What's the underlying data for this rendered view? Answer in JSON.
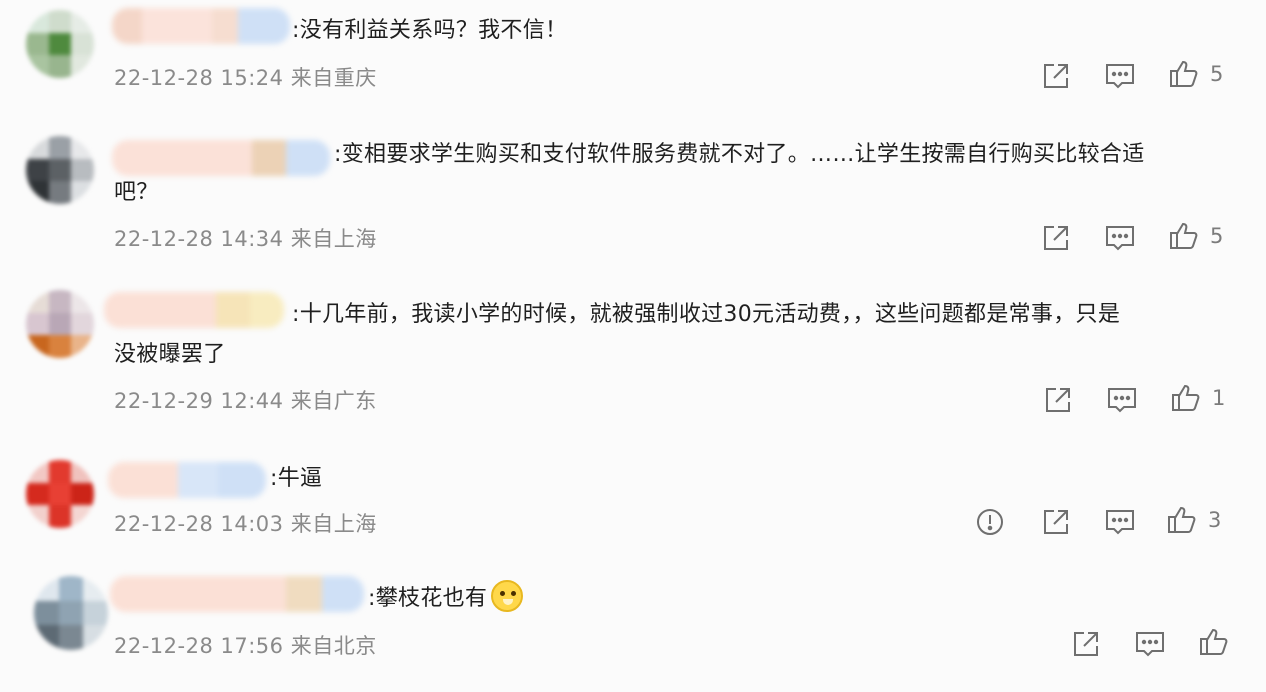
{
  "comments": [
    {
      "separator": ":",
      "text": "没有利益关系吗？我不信！",
      "text2": "",
      "date": "22-12-28 15:24",
      "location": "来自重庆",
      "likes": "5",
      "report": false
    },
    {
      "separator": ":",
      "text": "变相要求学生购买和支付软件服务费就不对了。……让学生按需自行购买比较合适",
      "text2": "吧？",
      "date": "22-12-28 14:34",
      "location": "来自上海",
      "likes": "5",
      "report": false
    },
    {
      "separator": ":",
      "text": "十几年前，我读小学的时候，就被强制收过30元活动费，，这些问题都是常事，只是",
      "text2": "没被曝罢了",
      "date": "22-12-29 12:44",
      "location": "来自广东",
      "likes": "1",
      "report": false
    },
    {
      "separator": ":",
      "text": "牛逼",
      "text2": "",
      "date": "22-12-28 14:03",
      "location": "来自上海",
      "likes": "3",
      "report": true
    },
    {
      "separator": ":",
      "text": "攀枝花也有",
      "text2": "",
      "date": "22-12-28 17:56",
      "location": "来自北京",
      "likes": "",
      "report": false
    }
  ],
  "icons": {
    "share": "share-icon",
    "reply": "comment-icon",
    "like": "thumbs-up-icon",
    "report": "report-icon"
  },
  "colors": {
    "meta": "#8a8a8a",
    "icon": "#6f6f6f"
  }
}
